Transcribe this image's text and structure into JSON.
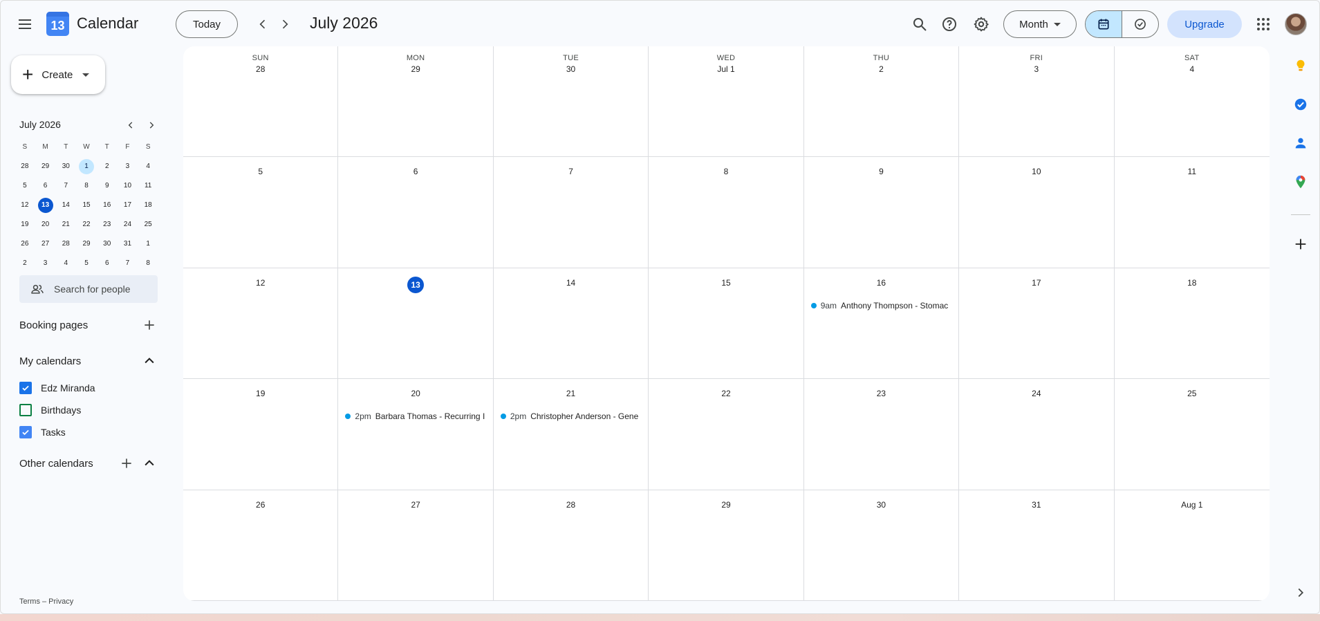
{
  "header": {
    "app_name": "Calendar",
    "logo_day": "13",
    "today_label": "Today",
    "title": "July 2026",
    "view_label": "Month",
    "upgrade_label": "Upgrade"
  },
  "sidebar": {
    "create_label": "Create",
    "mini_cal": {
      "title": "July 2026",
      "weekdays": [
        "S",
        "M",
        "T",
        "W",
        "T",
        "F",
        "S"
      ],
      "weeks": [
        [
          "28",
          "29",
          "30",
          "1",
          "2",
          "3",
          "4"
        ],
        [
          "5",
          "6",
          "7",
          "8",
          "9",
          "10",
          "11"
        ],
        [
          "12",
          "13",
          "14",
          "15",
          "16",
          "17",
          "18"
        ],
        [
          "19",
          "20",
          "21",
          "22",
          "23",
          "24",
          "25"
        ],
        [
          "26",
          "27",
          "28",
          "29",
          "30",
          "31",
          "1"
        ],
        [
          "2",
          "3",
          "4",
          "5",
          "6",
          "7",
          "8"
        ]
      ],
      "today": "13",
      "selected": "1"
    },
    "search_placeholder": "Search for people",
    "booking_pages": "Booking pages",
    "my_calendars": "My calendars",
    "calendars": [
      {
        "label": "Edz Miranda",
        "checked": true,
        "color": "#1a73e8"
      },
      {
        "label": "Birthdays",
        "checked": false,
        "color": "#0b8043"
      },
      {
        "label": "Tasks",
        "checked": true,
        "color": "#4285f4"
      }
    ],
    "other_calendars": "Other calendars",
    "footer": "Terms – Privacy"
  },
  "month": {
    "weekdays": [
      "SUN",
      "MON",
      "TUE",
      "WED",
      "THU",
      "FRI",
      "SAT"
    ],
    "weeks": [
      [
        "28",
        "29",
        "30",
        "Jul 1",
        "2",
        "3",
        "4"
      ],
      [
        "5",
        "6",
        "7",
        "8",
        "9",
        "10",
        "11"
      ],
      [
        "12",
        "13",
        "14",
        "15",
        "16",
        "17",
        "18"
      ],
      [
        "19",
        "20",
        "21",
        "22",
        "23",
        "24",
        "25"
      ],
      [
        "26",
        "27",
        "28",
        "29",
        "30",
        "31",
        "Aug 1"
      ]
    ],
    "today": "13",
    "events": [
      {
        "week": 2,
        "day": 4,
        "time": "9am",
        "title": "Anthony Thompson - Stomac",
        "color": "#039be5"
      },
      {
        "week": 3,
        "day": 1,
        "time": "2pm",
        "title": "Barbara Thomas - Recurring I",
        "color": "#039be5"
      },
      {
        "week": 3,
        "day": 2,
        "time": "2pm",
        "title": "Christopher Anderson - Gene",
        "color": "#039be5"
      }
    ]
  },
  "colors": {
    "accent": "#0b57d0",
    "today_bg": "#0b57d0",
    "selected_bg": "#c2e7ff",
    "upgrade_bg": "#d3e3fd"
  }
}
